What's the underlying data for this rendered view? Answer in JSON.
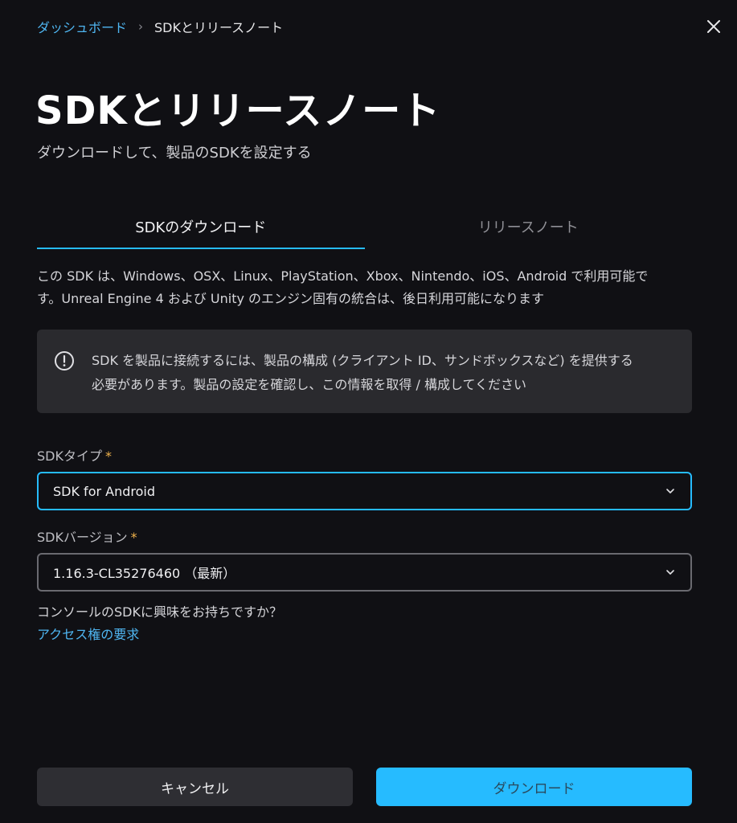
{
  "breadcrumb": {
    "parent": "ダッシュボード",
    "separator": "›",
    "current": "SDKとリリースノート"
  },
  "header": {
    "title": "SDKとリリースノート",
    "subtitle": "ダウンロードして、製品のSDKを設定する"
  },
  "tabs": [
    {
      "label": "SDKのダウンロード",
      "active": true
    },
    {
      "label": "リリースノート",
      "active": false
    }
  ],
  "description": {
    "line1": "この SDK は、Windows、OSX、Linux、PlayStation、Xbox、Nintendo、iOS、Android で利用可能で",
    "line2": "す。Unreal Engine 4 および Unity のエンジン固有の統合は、後日利用可能になります"
  },
  "notice": {
    "icon": "info-circle-icon",
    "line1": "SDK を製品に接続するには、製品の構成 (クライアント ID、サンドボックスなど) を提供する",
    "line2": "必要があります。製品の設定を確認し、この情報を取得 / 構成してください"
  },
  "form": {
    "sdk_type": {
      "label": "SDKタイプ",
      "required_mark": "*",
      "value": "SDK for Android"
    },
    "sdk_version": {
      "label": "SDKバージョン",
      "required_mark": "*",
      "value": "1.16.3-CL35276460 （最新）"
    }
  },
  "console": {
    "question": "コンソールのSDKに興味をお持ちですか？",
    "link": "アクセス権の要求"
  },
  "buttons": {
    "cancel": "キャンセル",
    "download": "ダウンロード"
  },
  "colors": {
    "background": "#101014",
    "accent": "#26bbff",
    "link": "#4fb6f2",
    "required": "#f0b34b",
    "notice_bg": "#2a2a2e"
  }
}
